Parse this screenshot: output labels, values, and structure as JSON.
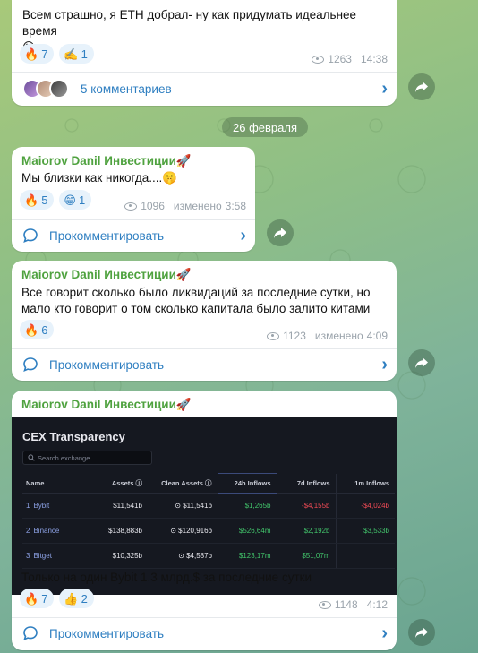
{
  "colors": {
    "accent": "#2f7fc1",
    "sender": "#4fa23f",
    "positive": "#42c46b",
    "negative": "#ef4a55"
  },
  "message0": {
    "text": "Всем страшно, я ETH добрал- ну как придумать идеальнее время",
    "emoji": "😅",
    "reactions": [
      {
        "icon": "🔥",
        "count": "7"
      },
      {
        "icon": "✍️",
        "count": "1"
      }
    ],
    "views": "1263",
    "time": "14:38",
    "comments_label": "5 комментариев"
  },
  "date_separator": "26 февраля",
  "message1": {
    "sender": "Maiorov Danil Инвестиции🚀",
    "text": "Мы близки как никогда....🤫",
    "reactions": [
      {
        "icon": "🔥",
        "count": "5"
      },
      {
        "icon": "😁",
        "count": "1"
      }
    ],
    "views": "1096",
    "edited": "изменено",
    "time": "3:58",
    "comment_label": "Прокомментировать"
  },
  "message2": {
    "sender": "Maiorov Danil Инвестиции🚀",
    "text_line1": "Все говорит сколько было ликвидаций за последние сутки, но",
    "text_line2": "мало кто говорит о том сколько капитала было залито китами",
    "reactions": [
      {
        "icon": "🔥",
        "count": "6"
      }
    ],
    "views": "1123",
    "edited": "изменено",
    "time": "4:09",
    "comment_label": "Прокомментировать"
  },
  "message3": {
    "sender": "Maiorov Danil Инвестиции🚀",
    "image": {
      "title": "CEX Transparency",
      "search_placeholder": "Search exchange...",
      "headers": [
        "Name",
        "Assets ⓘ",
        "Clean Assets ⓘ",
        "24h Inflows",
        "7d Inflows",
        "1m Inflows"
      ],
      "rows": [
        {
          "num": "1",
          "name": "Bybit",
          "assets": "$11,541b",
          "clean": "$11,541b",
          "h24": "$1,265b",
          "d7": "-$4,155b",
          "m1": "-$4,024b"
        },
        {
          "num": "2",
          "name": "Binance",
          "assets": "$138,883b",
          "clean": "$120,916b",
          "h24": "$526,64m",
          "d7": "$2,192b",
          "m1": "$3,533b"
        },
        {
          "num": "3",
          "name": "Bitget",
          "assets": "$10,325b",
          "clean": "$4,587b",
          "h24": "$123,17m",
          "d7": "$51,07m",
          "m1": ""
        }
      ]
    },
    "text": "Только на один Bybit 1.3 млрд.$ за последние сутки",
    "reactions": [
      {
        "icon": "🔥",
        "count": "7"
      },
      {
        "icon": "👍",
        "count": "2"
      }
    ],
    "views": "1148",
    "time": "4:12",
    "comment_label": "Прокомментировать"
  }
}
